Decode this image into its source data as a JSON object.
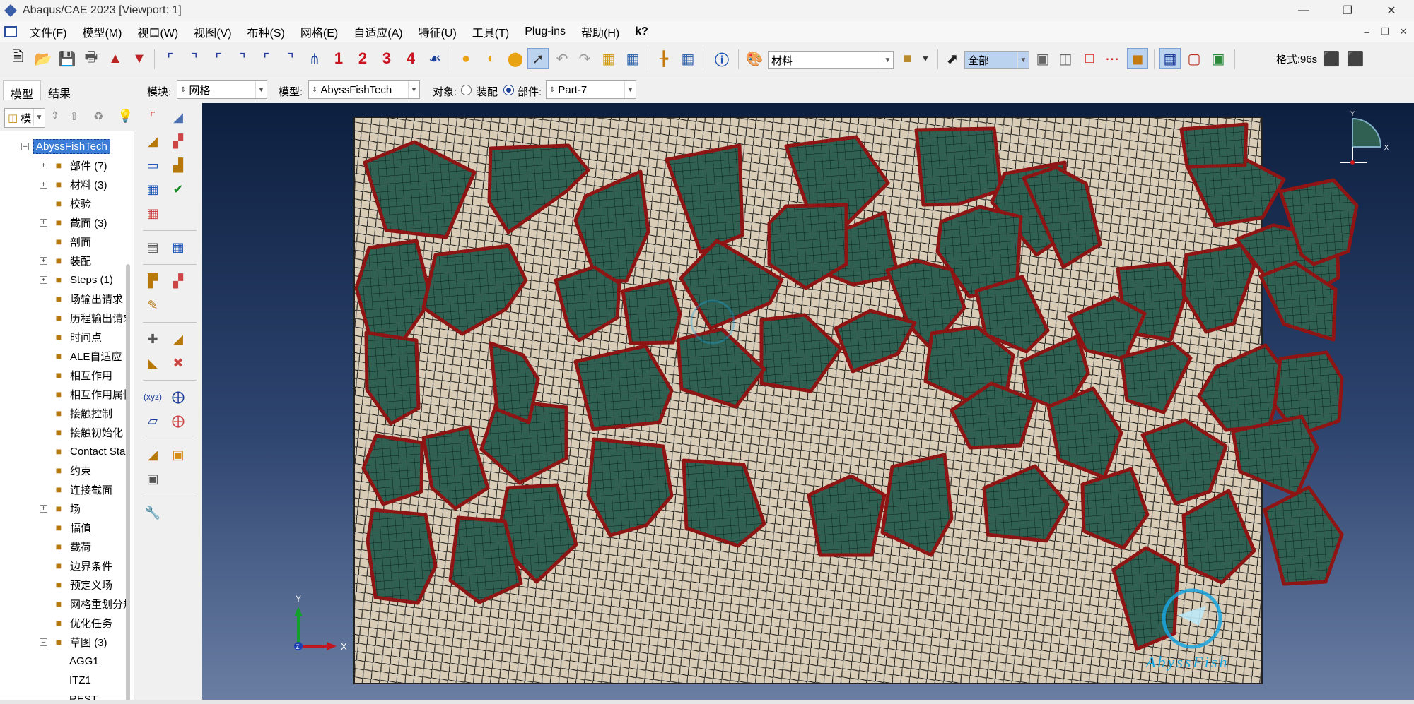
{
  "window": {
    "title": "Abaqus/CAE 2023 [Viewport: 1]"
  },
  "menubar": {
    "items": [
      "文件(F)",
      "模型(M)",
      "视口(W)",
      "视图(V)",
      "布种(S)",
      "网格(E)",
      "自适应(A)",
      "特征(U)",
      "工具(T)",
      "Plug-ins",
      "帮助(H)",
      "k?"
    ]
  },
  "toolbar": {
    "material_combo": "材料",
    "selection_combo": "全部",
    "format_label": "格式:96s",
    "step_numbers": [
      "1",
      "2",
      "3",
      "4"
    ]
  },
  "context": {
    "module_label": "模块:",
    "module_value": "网格",
    "model_label": "模型:",
    "model_value": "AbyssFishTech",
    "object_label": "对象:",
    "assembly_option": "装配",
    "part_option": "部件:",
    "part_value": "Part-7"
  },
  "tabs": [
    "模型",
    "结果"
  ],
  "tree_combo": "模",
  "tree": {
    "root": "AbyssFishTech",
    "nodes": [
      {
        "label": "部件 (7)",
        "icon": "part-icon",
        "expandable": true
      },
      {
        "label": "材料 (3)",
        "icon": "material-icon",
        "expandable": true
      },
      {
        "label": "校验",
        "icon": "calibration-icon",
        "expandable": false
      },
      {
        "label": "截面 (3)",
        "icon": "section-icon",
        "expandable": true
      },
      {
        "label": "剖面",
        "icon": "profile-icon",
        "expandable": false
      },
      {
        "label": "装配",
        "icon": "assembly-icon",
        "expandable": true
      },
      {
        "label": "Steps (1)",
        "icon": "steps-icon",
        "expandable": true
      },
      {
        "label": "场输出请求",
        "icon": "field-output-icon",
        "expandable": false
      },
      {
        "label": "历程输出请求",
        "icon": "history-output-icon",
        "expandable": false
      },
      {
        "label": "时间点",
        "icon": "time-points-icon",
        "expandable": false
      },
      {
        "label": "ALE自适应",
        "icon": "ale-icon",
        "expandable": false
      },
      {
        "label": "相互作用",
        "icon": "interaction-icon",
        "expandable": false
      },
      {
        "label": "相互作用属性",
        "icon": "interaction-property-icon",
        "expandable": false
      },
      {
        "label": "接触控制",
        "icon": "contact-control-icon",
        "expandable": false
      },
      {
        "label": "接触初始化",
        "icon": "contact-init-icon",
        "expandable": false
      },
      {
        "label": "Contact Stabilization",
        "icon": "contact-stab-icon",
        "expandable": false
      },
      {
        "label": "约束",
        "icon": "constraint-icon",
        "expandable": false
      },
      {
        "label": "连接截面",
        "icon": "connector-section-icon",
        "expandable": false
      },
      {
        "label": "场",
        "icon": "field-icon",
        "expandable": true
      },
      {
        "label": "幅值",
        "icon": "amplitude-icon",
        "expandable": false
      },
      {
        "label": "载荷",
        "icon": "load-icon",
        "expandable": false
      },
      {
        "label": "边界条件",
        "icon": "bc-icon",
        "expandable": false
      },
      {
        "label": "预定义场",
        "icon": "predefined-field-icon",
        "expandable": false
      },
      {
        "label": "网格重划分规则",
        "icon": "remesh-icon",
        "expandable": false
      },
      {
        "label": "优化任务",
        "icon": "optimization-icon",
        "expandable": false
      },
      {
        "label": "草图 (3)",
        "icon": "sketch-icon",
        "expandable": true,
        "expanded": true
      }
    ],
    "sketches": [
      "AGG1",
      "ITZ1",
      "REST"
    ]
  },
  "viewport": {
    "triad": {
      "x": "X",
      "y": "Y",
      "z": "Z"
    },
    "mini_triad": {
      "x": "X",
      "y": "Y"
    },
    "watermark": "AbyssFish"
  },
  "colors": {
    "aggregate": "#2f6052",
    "aggregate_border": "#8f1414",
    "matrix": "#d9cdb8",
    "mesh_line": "#141414",
    "step_number": "#c9141f",
    "tree_selected": "#3b7cd6"
  }
}
